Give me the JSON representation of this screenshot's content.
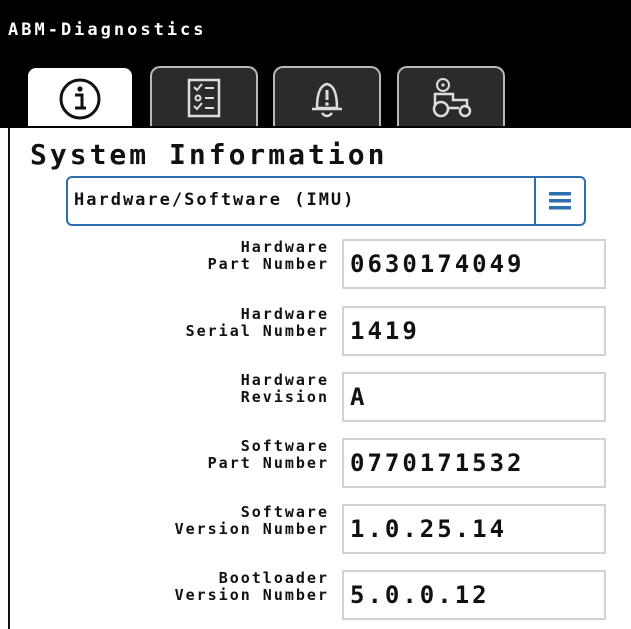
{
  "window": {
    "title": "ABM-Diagnostics"
  },
  "tabs": [
    {
      "icon": "info-icon",
      "active": true
    },
    {
      "icon": "checklist-icon",
      "active": false
    },
    {
      "icon": "bell-alarm-icon",
      "active": false
    },
    {
      "icon": "tractor-diagnostics-icon",
      "active": false
    }
  ],
  "page": {
    "title": "System Information"
  },
  "selector": {
    "value": "Hardware/Software (IMU)",
    "menu_icon": "hamburger-menu-icon",
    "accent": "#2e6fb0"
  },
  "fields": [
    {
      "label_line1": "Hardware",
      "label_line2": "Part Number",
      "value": "0630174049"
    },
    {
      "label_line1": "Hardware",
      "label_line2": "Serial Number",
      "value": "1419"
    },
    {
      "label_line1": "Hardware",
      "label_line2": "Revision",
      "value": "A"
    },
    {
      "label_line1": "Software",
      "label_line2": "Part Number",
      "value": "0770171532"
    },
    {
      "label_line1": "Software",
      "label_line2": "Version Number",
      "value": "1.0.25.14"
    },
    {
      "label_line1": "Bootloader",
      "label_line2": "Version Number",
      "value": "5.0.0.12"
    }
  ]
}
